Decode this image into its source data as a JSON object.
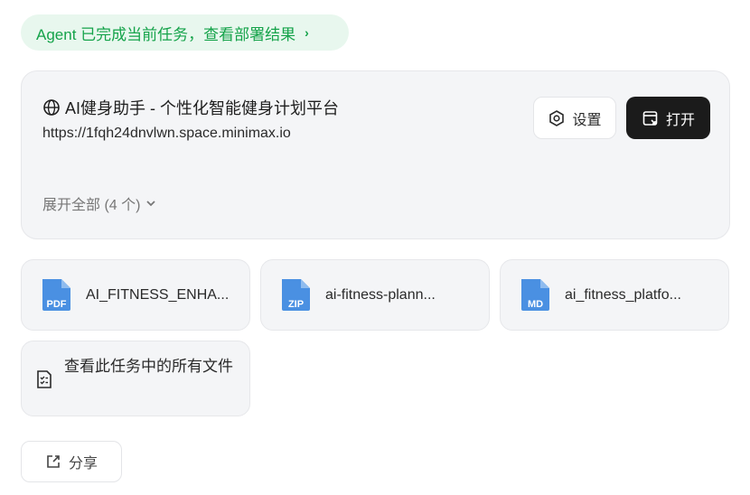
{
  "status": {
    "text": "Agent 已完成当前任务，查看部署结果",
    "chevron": "›",
    "color": "#15a34a",
    "icon": "chevron-right-icon"
  },
  "deploy": {
    "title": "AI健身助手 - 个性化智能健身计划平台",
    "url": "https://1fqh24dnvlwn.space.minimax.io",
    "expand_label": "展开全部 (4 个)",
    "settings_label": "设置",
    "open_label": "打开",
    "icons": {
      "title": "globe-icon",
      "settings": "settings-hexagon-icon",
      "open": "open-window-icon",
      "expand": "chevron-down-icon"
    }
  },
  "files": [
    {
      "name": "AI_FITNESS_ENHANCED_REPORT.pdf",
      "display": "AI_FITNESS_ENHA...",
      "type": "PDF",
      "color": "#4a90e2"
    },
    {
      "name": "ai-fitness-planner.zip",
      "display": "ai-fitness-plann...",
      "type": "ZIP",
      "color": "#4a90e2"
    },
    {
      "name": "ai_fitness_platform.md",
      "display": "ai_fitness_platfo...",
      "type": "MD",
      "color": "#4a90e2"
    }
  ],
  "all_files": {
    "label": "查看此任务中的所有文件",
    "icon": "file-checklist-icon"
  },
  "share": {
    "label": "分享",
    "icon": "share-icon"
  }
}
